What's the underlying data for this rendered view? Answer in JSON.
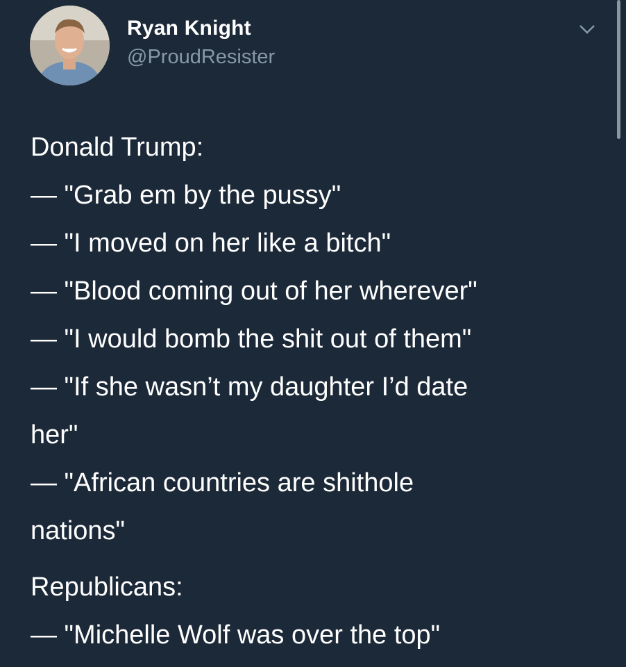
{
  "user": {
    "name": "Ryan Knight",
    "handle": "@ProudResister"
  },
  "tweet": {
    "section1_heading": "Donald Trump:",
    "section1_lines": [
      "— \"Grab em by the pussy\"",
      "— \"I moved on her like a bitch\"",
      "— \"Blood coming out of her wherever\"",
      "— \"I would bomb the shit out of them\"",
      "— \"If she wasn’t my daughter I’d date",
      "her\"",
      "— \"African countries are shithole",
      "nations\""
    ],
    "section2_heading": "Republicans:",
    "section2_lines": [
      "— \"Michelle Wolf was over the top\""
    ]
  },
  "icons": {
    "menu": "chevron-down-icon",
    "avatar": "avatar"
  },
  "colors": {
    "background": "#1c2938",
    "text": "#ffffff",
    "handle": "#8899a6"
  }
}
